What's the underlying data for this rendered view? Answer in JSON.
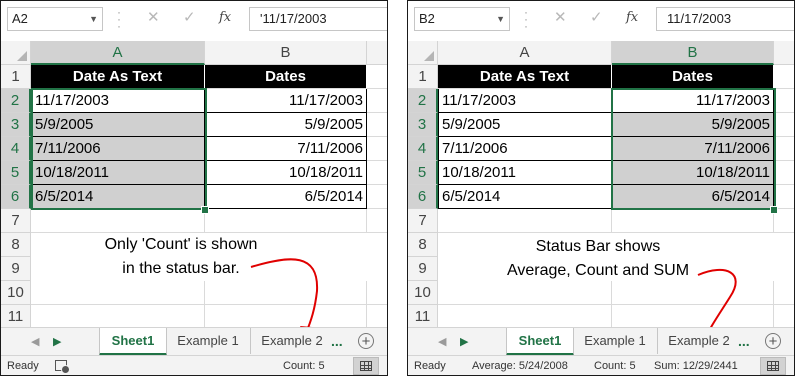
{
  "panels": [
    {
      "namebox": "A2",
      "formula": "'11/17/2003",
      "selected_column": "A",
      "columns": [
        "A",
        "B"
      ],
      "rows": [
        "1",
        "2",
        "3",
        "4",
        "5",
        "6",
        "7",
        "8",
        "9",
        "10",
        "11"
      ],
      "header": {
        "a": "Date As Text",
        "b": "Dates"
      },
      "data": [
        {
          "a": "11/17/2003",
          "b": "11/17/2003"
        },
        {
          "a": "5/9/2005",
          "b": "5/9/2005"
        },
        {
          "a": "7/11/2006",
          "b": "7/11/2006"
        },
        {
          "a": "10/18/2011",
          "b": "10/18/2011"
        },
        {
          "a": "6/5/2014",
          "b": "6/5/2014"
        }
      ],
      "annotation": {
        "line1": "Only 'Count' is shown",
        "line2": "in the status bar."
      },
      "tabs": {
        "active": "Sheet1",
        "t2": "Example 1",
        "t3": "Example 2",
        "ellipsis": "..."
      },
      "status": {
        "ready": "Ready",
        "count": "Count: 5"
      }
    },
    {
      "namebox": "B2",
      "formula": "11/17/2003",
      "selected_column": "B",
      "columns": [
        "A",
        "B"
      ],
      "rows": [
        "1",
        "2",
        "3",
        "4",
        "5",
        "6",
        "7",
        "8",
        "9",
        "10",
        "11"
      ],
      "header": {
        "a": "Date As Text",
        "b": "Dates"
      },
      "data": [
        {
          "a": "11/17/2003",
          "b": "11/17/2003"
        },
        {
          "a": "5/9/2005",
          "b": "5/9/2005"
        },
        {
          "a": "7/11/2006",
          "b": "7/11/2006"
        },
        {
          "a": "10/18/2011",
          "b": "10/18/2011"
        },
        {
          "a": "6/5/2014",
          "b": "6/5/2014"
        }
      ],
      "annotation": {
        "line1": "Status Bar shows",
        "line2": "Average, Count and SUM"
      },
      "tabs": {
        "active": "Sheet1",
        "t2": "Example 1",
        "t3": "Example 2",
        "ellipsis": "..."
      },
      "status": {
        "ready": "Ready",
        "average": "Average: 5/24/2008",
        "count": "Count: 5",
        "sum": "Sum: 12/29/2441"
      }
    }
  ],
  "colors": {
    "excel_green": "#217346",
    "selection_shade": "#d0d0d0",
    "annotation_arrow": "#e00000"
  },
  "icons": [
    "cancel-icon",
    "enter-icon",
    "fx-icon",
    "add-sheet-icon",
    "normal-view-icon",
    "macro-record-icon"
  ]
}
